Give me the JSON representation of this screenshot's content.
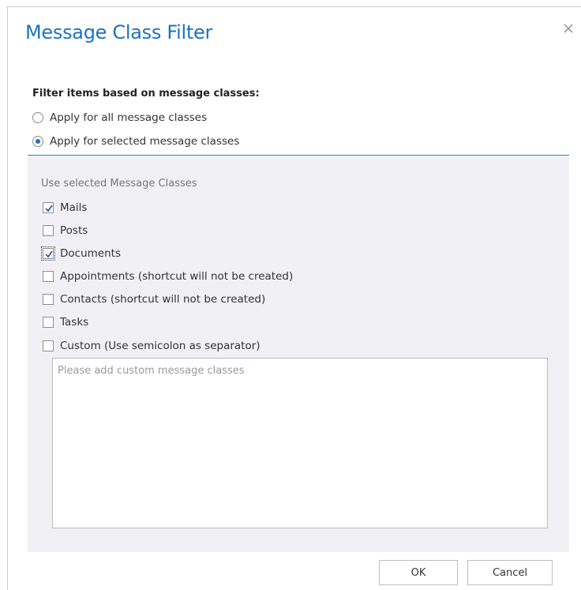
{
  "dialog": {
    "title": "Message Class Filter",
    "close_icon": "close-icon"
  },
  "filter": {
    "section_label": "Filter items based on message classes:",
    "options": [
      {
        "label": "Apply for all message classes",
        "selected": false
      },
      {
        "label": "Apply for selected message classes",
        "selected": true
      }
    ]
  },
  "classes": {
    "caption": "Use selected Message Classes",
    "items": [
      {
        "label": "Mails",
        "checked": true
      },
      {
        "label": "Posts",
        "checked": false
      },
      {
        "label": "Documents",
        "checked": true,
        "focused": true
      },
      {
        "label": "Appointments (shortcut will not be created)",
        "checked": false
      },
      {
        "label": "Contacts (shortcut will not be created)",
        "checked": false
      },
      {
        "label": "Tasks",
        "checked": false
      },
      {
        "label": "Custom (Use semicolon as separator)",
        "checked": false
      }
    ],
    "custom_value": "",
    "custom_placeholder": "Please add custom message classes"
  },
  "buttons": {
    "ok_label": "OK",
    "cancel_label": "Cancel"
  },
  "colors": {
    "accent": "#1a73c0",
    "panel_bg": "#f1f0f4",
    "divider": "#3a7bc8"
  }
}
